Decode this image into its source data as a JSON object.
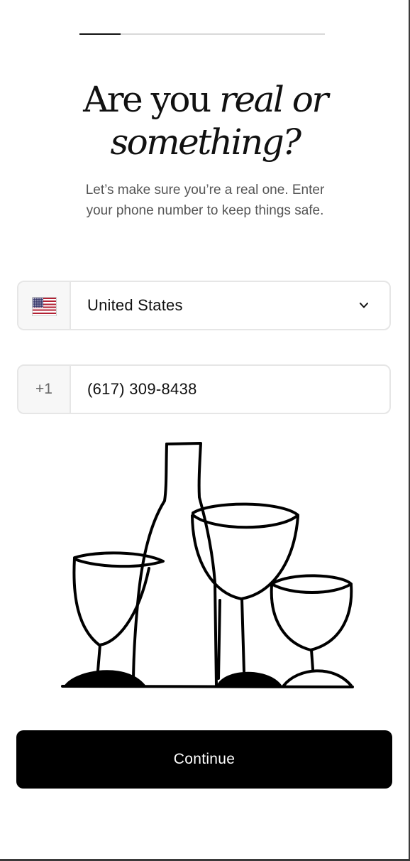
{
  "progress": {
    "fraction": 0.167
  },
  "heading": {
    "line1_plain": "Are you ",
    "line1_italic": "real or",
    "line2_italic": "something?"
  },
  "subtitle": "Let’s make sure you’re a real one. Enter your phone number to keep things safe.",
  "country_select": {
    "flag_icon": "us-flag-icon",
    "selected_value": "United States",
    "chevron_icon": "chevron-down-icon"
  },
  "phone_field": {
    "dial_code": "+1",
    "value": "(617) 309-8438"
  },
  "illustration": {
    "name": "wine-bottle-and-glasses-illustration"
  },
  "continue_button": {
    "label": "Continue"
  },
  "colors": {
    "primary": "#000000",
    "border": "#e6e6e6",
    "muted_text": "#555555"
  }
}
